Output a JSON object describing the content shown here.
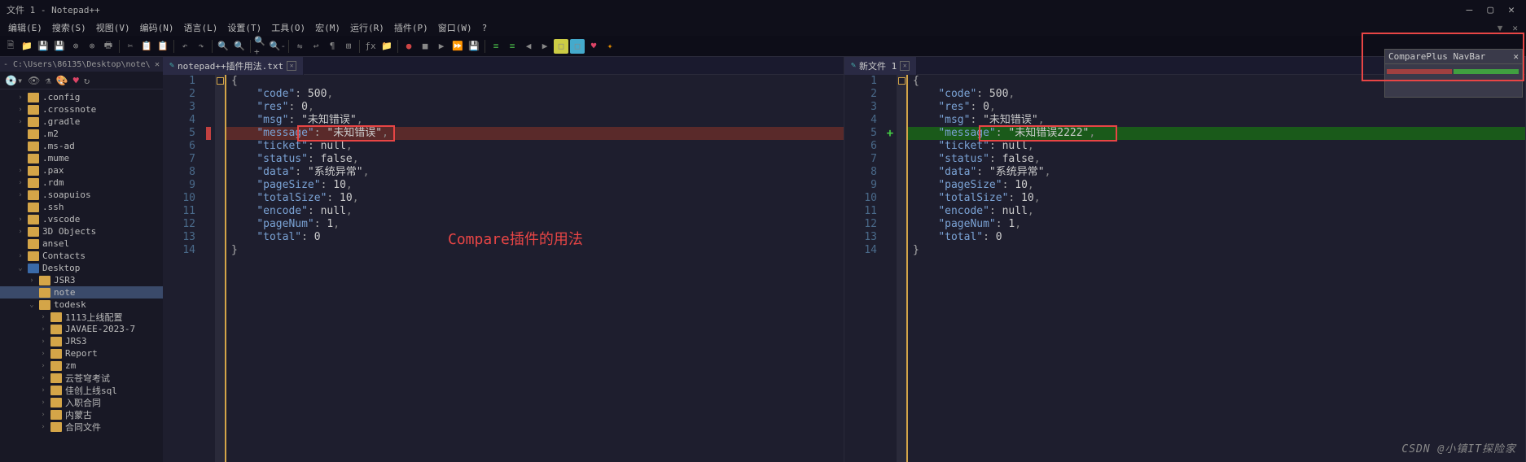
{
  "titlebar": {
    "title": "文件 1 - Notepad++"
  },
  "menubar": {
    "items": [
      "编辑(E)",
      "搜索(S)",
      "视图(V)",
      "编码(N)",
      "语言(L)",
      "设置(T)",
      "工具(O)",
      "宏(M)",
      "运行(R)",
      "插件(P)",
      "窗口(W)",
      "?"
    ]
  },
  "sidebar": {
    "path": "- C:\\Users\\86135\\Desktop\\note\\",
    "items": [
      {
        "label": ".config",
        "depth": 1,
        "exp": ">",
        "fld": "o"
      },
      {
        "label": ".crossnote",
        "depth": 1,
        "exp": ">",
        "fld": "o"
      },
      {
        "label": ".gradle",
        "depth": 1,
        "exp": ">",
        "fld": "o"
      },
      {
        "label": ".m2",
        "depth": 1,
        "exp": "",
        "fld": "o"
      },
      {
        "label": ".ms-ad",
        "depth": 1,
        "exp": "",
        "fld": "o"
      },
      {
        "label": ".mume",
        "depth": 1,
        "exp": "",
        "fld": "o"
      },
      {
        "label": ".pax",
        "depth": 1,
        "exp": ">",
        "fld": "o"
      },
      {
        "label": ".rdm",
        "depth": 1,
        "exp": ">",
        "fld": "o"
      },
      {
        "label": ".soapuios",
        "depth": 1,
        "exp": ">",
        "fld": "o"
      },
      {
        "label": ".ssh",
        "depth": 1,
        "exp": "",
        "fld": "o"
      },
      {
        "label": ".vscode",
        "depth": 1,
        "exp": ">",
        "fld": "o"
      },
      {
        "label": "3D Objects",
        "depth": 1,
        "exp": ">",
        "fld": "o"
      },
      {
        "label": "ansel",
        "depth": 1,
        "exp": "",
        "fld": "o"
      },
      {
        "label": "Contacts",
        "depth": 1,
        "exp": ">",
        "fld": "o"
      },
      {
        "label": "Desktop",
        "depth": 1,
        "exp": "v",
        "fld": "blue"
      },
      {
        "label": "JSR3",
        "depth": 2,
        "exp": ">",
        "fld": "o"
      },
      {
        "label": "note",
        "depth": 2,
        "exp": "",
        "fld": "o",
        "sel": true
      },
      {
        "label": "todesk",
        "depth": 2,
        "exp": "v",
        "fld": "o"
      },
      {
        "label": "1113上线配置",
        "depth": 3,
        "exp": ">",
        "fld": "o"
      },
      {
        "label": "JAVAEE-2023-7",
        "depth": 3,
        "exp": ">",
        "fld": "o"
      },
      {
        "label": "JRS3",
        "depth": 3,
        "exp": ">",
        "fld": "o"
      },
      {
        "label": "Report",
        "depth": 3,
        "exp": ">",
        "fld": "o"
      },
      {
        "label": "zm",
        "depth": 3,
        "exp": ">",
        "fld": "o"
      },
      {
        "label": "云苍穹考试",
        "depth": 3,
        "exp": ">",
        "fld": "o"
      },
      {
        "label": "佳创上线sql",
        "depth": 3,
        "exp": ">",
        "fld": "o"
      },
      {
        "label": "入职合同",
        "depth": 3,
        "exp": ">",
        "fld": "o"
      },
      {
        "label": "内蒙古",
        "depth": 3,
        "exp": ">",
        "fld": "o"
      },
      {
        "label": "合同文件",
        "depth": 3,
        "exp": ">",
        "fld": "o"
      }
    ]
  },
  "editors": {
    "left": {
      "tab": "notepad++插件用法.txt",
      "lines": [
        {
          "n": 1,
          "t": "{"
        },
        {
          "n": 2,
          "t": "    \"code\": 500,"
        },
        {
          "n": 3,
          "t": "    \"res\": 0,"
        },
        {
          "n": 4,
          "t": "    \"msg\": \"未知错误\","
        },
        {
          "n": 5,
          "t": "    \"message\": \"未知错误\",",
          "cls": "diff-del",
          "mk": "del"
        },
        {
          "n": 6,
          "t": "    \"ticket\": null,"
        },
        {
          "n": 7,
          "t": "    \"status\": false,"
        },
        {
          "n": 8,
          "t": "    \"data\": \"系统异常\","
        },
        {
          "n": 9,
          "t": "    \"pageSize\": 10,"
        },
        {
          "n": 10,
          "t": "    \"totalSize\": 10,"
        },
        {
          "n": 11,
          "t": "    \"encode\": null,"
        },
        {
          "n": 12,
          "t": "    \"pageNum\": 1,"
        },
        {
          "n": 13,
          "t": "    \"total\": 0"
        },
        {
          "n": 14,
          "t": "}"
        }
      ]
    },
    "right": {
      "tab": "新文件 1",
      "lines": [
        {
          "n": 1,
          "t": "{"
        },
        {
          "n": 2,
          "t": "    \"code\": 500,"
        },
        {
          "n": 3,
          "t": "    \"res\": 0,"
        },
        {
          "n": 4,
          "t": "    \"msg\": \"未知错误\","
        },
        {
          "n": 5,
          "t": "    \"message\": \"未知错误2222\",",
          "cls": "diff-add",
          "mk": "add"
        },
        {
          "n": 6,
          "t": "    \"ticket\": null,"
        },
        {
          "n": 7,
          "t": "    \"status\": false,"
        },
        {
          "n": 8,
          "t": "    \"data\": \"系统异常\","
        },
        {
          "n": 9,
          "t": "    \"pageSize\": 10,"
        },
        {
          "n": 10,
          "t": "    \"totalSize\": 10,"
        },
        {
          "n": 11,
          "t": "    \"encode\": null,"
        },
        {
          "n": 12,
          "t": "    \"pageNum\": 1,"
        },
        {
          "n": 13,
          "t": "    \"total\": 0"
        },
        {
          "n": 14,
          "t": "}"
        }
      ]
    }
  },
  "overlay": {
    "text": "Compare插件的用法"
  },
  "navbar": {
    "title": "ComparePlus NavBar"
  },
  "watermark": "CSDN @小镇IT探险家"
}
